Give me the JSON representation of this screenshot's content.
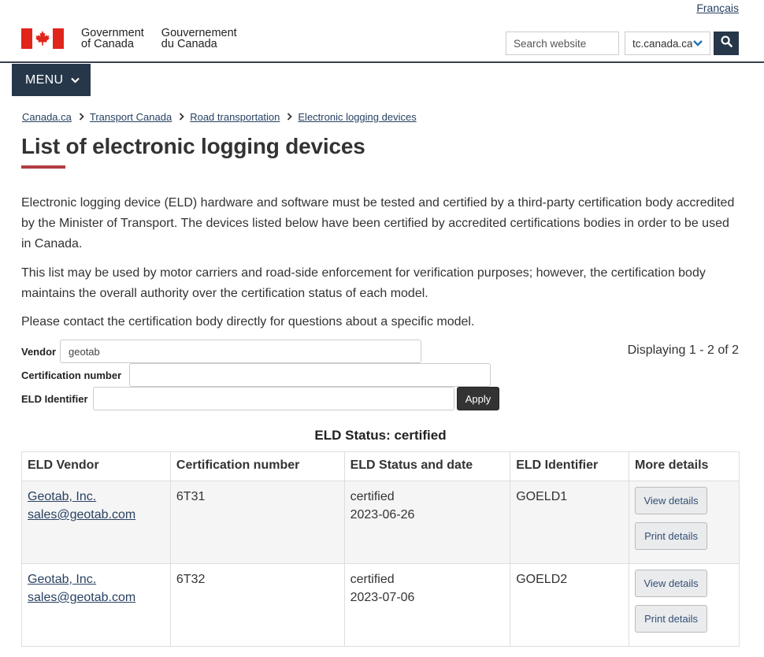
{
  "header": {
    "lang_link": "Français",
    "fip_en_line1": "Government",
    "fip_en_line2": "of Canada",
    "fip_fr_line1": "Gouvernement",
    "fip_fr_line2": "du Canada",
    "search_placeholder": "Search website",
    "scope_value": "tc.canada.ca",
    "menu_label": "MENU"
  },
  "breadcrumb": [
    "Canada.ca",
    "Transport Canada",
    "Road transportation",
    "Electronic logging devices"
  ],
  "page_title": "List of electronic logging devices",
  "paragraphs": {
    "p1": "Electronic logging device (ELD) hardware and software must be tested and certified by a third-party certification body accredited by the Minister of Transport. The devices listed below have been certified by accredited certifications bodies in order to be used in Canada.",
    "p2": "This list may be used by motor carriers and road-side enforcement for verification purposes; however, the certification body maintains the overall authority over the certification status of each model.",
    "p3": "Please contact the certification body directly for questions about a specific model."
  },
  "filters": {
    "vendor_label": "Vendor",
    "vendor_value": "geotab",
    "cert_label": "Certification number",
    "cert_value": "",
    "eld_label": "ELD Identifier",
    "eld_value": "",
    "apply_label": "Apply",
    "displaying": "Displaying 1 - 2 of 2"
  },
  "table": {
    "caption": "ELD Status: certified",
    "headers": [
      "ELD Vendor",
      "Certification number",
      "ELD Status and date",
      "ELD Identifier",
      "More details"
    ],
    "rows": [
      {
        "vendor": "Geotab, Inc.",
        "email": "sales@geotab.com",
        "cert": "6T31",
        "status": "certified",
        "date": "2023-06-26",
        "eld_id": "GOELD1",
        "view": "View details",
        "print": "Print details"
      },
      {
        "vendor": "Geotab, Inc.",
        "email": "sales@geotab.com",
        "cert": "6T32",
        "status": "certified",
        "date": "2023-07-06",
        "eld_id": "GOELD2",
        "view": "View details",
        "print": "Print details"
      }
    ]
  },
  "colors": {
    "brand_dark": "#26374a",
    "flag_red": "#e1251b",
    "title_accent": "#af3c43",
    "link": "#284162"
  },
  "icons": [
    "canada-flag-icon",
    "chevron-down-icon",
    "search-icon",
    "chevron-right-icon"
  ]
}
